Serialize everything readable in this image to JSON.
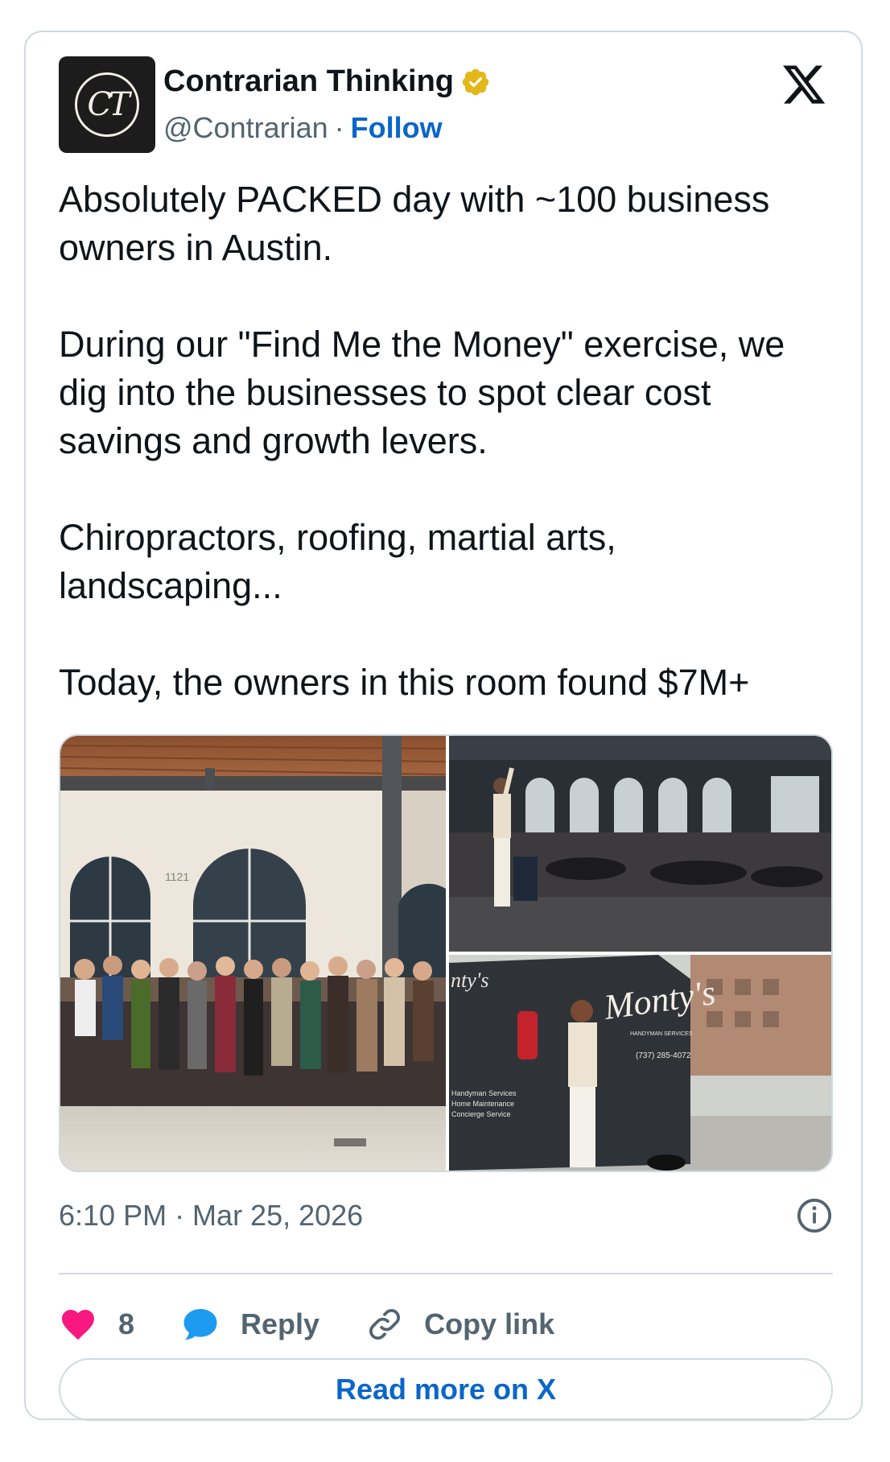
{
  "author": {
    "display_name": "Contrarian Thinking",
    "handle": "@Contrarian",
    "separator": "·",
    "follow_label": "Follow",
    "avatar_initials": "CT"
  },
  "tweet": {
    "paragraphs": [
      "Absolutely PACKED day with ~100 business owners in Austin.",
      "During our \"Find Me the Money\" exercise, we dig into the businesses to spot clear cost savings and growth levers.",
      "Chiropractors, roofing, martial arts, landscaping...",
      "Today, the owners in this room found $7M+"
    ],
    "timestamp": "6:10 PM · Mar 25, 2026"
  },
  "photos": {
    "group_sign": "1121",
    "van_brand": "Monty's",
    "van_subtitle": "HANDYMAN SERVICES",
    "van_phone": "(737) 285-4072",
    "van_services": [
      "Handyman Services",
      "Home Maintenance",
      "Concierge Service"
    ],
    "van_left_fragment": "nty's"
  },
  "actions": {
    "like_count": "8",
    "reply_label": "Reply",
    "copy_label": "Copy link"
  },
  "read_more_label": "Read more on X",
  "colors": {
    "link_blue": "#0a66c9",
    "heart": "#f91880",
    "reply_blue": "#1d9bf0",
    "verified_gold": "#e2b719",
    "border": "#cfd9de",
    "muted_text": "#536471"
  }
}
